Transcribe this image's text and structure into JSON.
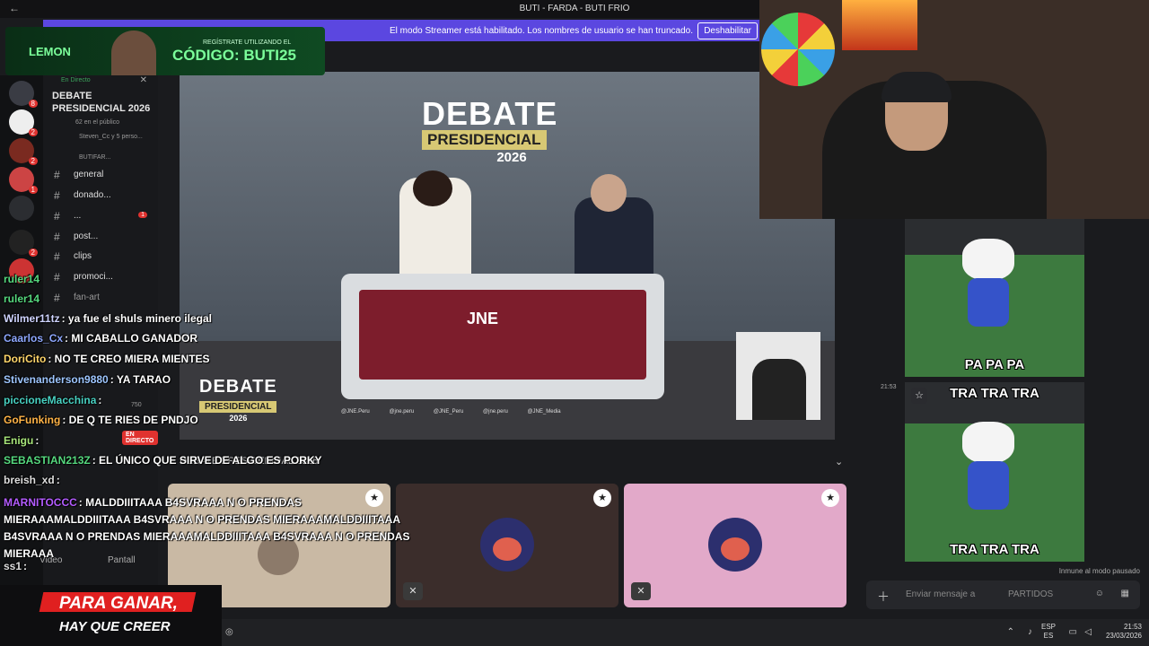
{
  "window": {
    "title": "BUTI - FARDA - BUTI FRIO",
    "back_glyph": "←",
    "fwd_glyph": "→"
  },
  "streamer_banner": {
    "text": "El modo Streamer está habilitado. Los nombres de usuario se han truncado.",
    "button": "Deshabilitar"
  },
  "ad": {
    "brand": "LEMON",
    "register": "REGÍSTRATE UTILIZANDO EL",
    "code": "CÓDIGO: BUTI25"
  },
  "server": {
    "live_label": "En Directo",
    "name": "DEBATE PRESIDENCIAL 2026",
    "audience": "62 en el público",
    "members": "Steven_Cc y 5 perso...",
    "category": "BUTIFAR...",
    "channels": [
      {
        "label": "general"
      },
      {
        "label": "donado..."
      },
      {
        "label": "...",
        "count": "1"
      },
      {
        "label": "post..."
      },
      {
        "label": "clips"
      },
      {
        "label": "promoci..."
      },
      {
        "label": "fan-art"
      }
    ],
    "badges": [
      "8",
      "2",
      "2",
      "1",
      "2"
    ]
  },
  "stream": {
    "debate_title": "DEBATE",
    "debate_sub": "PRESIDENCIAL",
    "debate_year": "2026",
    "desk_logo": "JNE",
    "socials": [
      "@JNE.Peru",
      "@jne.peru",
      "@JNE_Peru",
      "@jne.peru",
      "@JNE_Media"
    ]
  },
  "video_bar": {
    "title": "DEBATE PRESIDENCIAL 2026",
    "chevron": "⌄"
  },
  "tiles": [
    {
      "bg": "#c9b9a4",
      "star": "★"
    },
    {
      "bg": "#3b2d2b",
      "star": "★",
      "mute": "✕"
    },
    {
      "bg": "#e2a9c9",
      "star": "★",
      "mute": "✕"
    }
  ],
  "voice": {
    "video": "Video",
    "screen": "Pantall"
  },
  "chat_overlay": [
    {
      "user": "ruler14",
      "color": "#56d97f",
      "text": ""
    },
    {
      "user": "ruler14",
      "color": "#56d97f",
      "text": ""
    },
    {
      "user": "Wilmer11tz",
      "color": "#cfd4ff",
      "text": ": ya fue el shuls minero ilegal"
    },
    {
      "user": "Caarlos_Cx",
      "color": "#8ea8ff",
      "text": ": MI CABALLO GANADOR"
    },
    {
      "user": "DoriCito",
      "color": "#ffd66b",
      "text": ": NO TE CREO MIERA MIENTES"
    },
    {
      "user": "Stivenanderson9880",
      "color": "#9ec6ff",
      "text": ": YA TARAO"
    },
    {
      "user": "piccioneMacchina",
      "color": "#48d1c2",
      "text": ":"
    },
    {
      "user": "GoFunking",
      "color": "#ffb347",
      "text": ": DE Q TE RIES DE PNDJO"
    },
    {
      "user": "Enigu",
      "color": "#a7e57a",
      "text": ":"
    },
    {
      "user": "SEBASTIAN213Z",
      "color": "#56d97f",
      "text": ": EL ÚNICO QUE SIRVE DE ALGO ES PORKY"
    },
    {
      "user": "breish_xd",
      "color": "#dddddd",
      "text": ":"
    },
    {
      "user": "MARNITOCCC",
      "color": "#b45cff",
      "text": ": MALDDIIITAAA B4SVRAAA N O PRENDAS MIERAAAMALDDIIITAAA B4SVRAAA N O PRENDAS MIERAAAMALDDIIITAAA B4SVRAAA N O PRENDAS MIERAAAMALDDIIITAAA B4SVRAAA N O PRENDAS MIERAAA"
    },
    {
      "user": "ss1",
      "color": "#dddddd",
      "text": ":"
    }
  ],
  "live_tag": "EN DIRECTO",
  "viewer_count": "750",
  "right_panel": {
    "time": "21:53",
    "memes": [
      {
        "caption": "PA PA PA"
      },
      {
        "caption_top": "TRA TRA TRA",
        "caption": "TRA TRA TRA"
      }
    ],
    "immune": "Inmune al modo pausado",
    "input_placeholder": "Enviar mensaje a",
    "input_channel": "PARTIDOS"
  },
  "promo": {
    "line1": "PARA GANAR,",
    "line2": "HAY QUE CREER"
  },
  "taskbar": {
    "lang1": "ESP",
    "lang2": "ES",
    "time": "21:53",
    "date": "23/03/2026"
  }
}
